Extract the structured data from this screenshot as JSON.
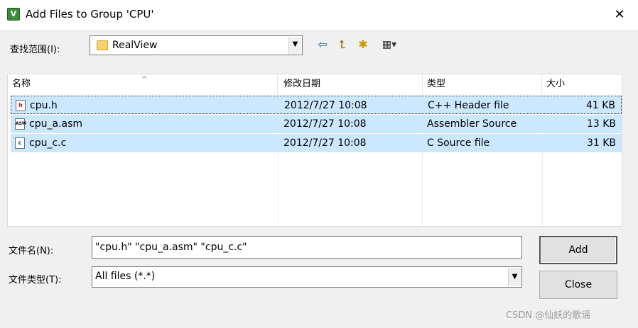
{
  "window": {
    "title": "Add Files to Group 'CPU'",
    "app_icon_text": "V",
    "close_glyph": "✕"
  },
  "lookin": {
    "label": "查找范围(I):",
    "value": "RealView"
  },
  "toolbar": {
    "back_icon": "back-arrow-icon",
    "up_icon": "up-folder-icon",
    "newfolder_icon": "new-folder-icon",
    "view_icon": "view-menu-icon"
  },
  "columns": [
    "名称",
    "修改日期",
    "类型",
    "大小"
  ],
  "files": [
    {
      "name": "cpu.h",
      "icon": "h",
      "modified": "2012/7/27 10:08",
      "type": "C++ Header file",
      "size": "41 KB"
    },
    {
      "name": "cpu_a.asm",
      "icon": "ASM",
      "modified": "2012/7/27 10:08",
      "type": "Assembler Source",
      "size": "13 KB"
    },
    {
      "name": "cpu_c.c",
      "icon": "c",
      "modified": "2012/7/27 10:08",
      "type": "C Source file",
      "size": "31 KB"
    }
  ],
  "filename": {
    "label": "文件名(N):",
    "value": "\"cpu.h\" \"cpu_a.asm\" \"cpu_c.c\""
  },
  "filetype": {
    "label": "文件类型(T):",
    "value": "All files (*.*)"
  },
  "buttons": {
    "add": "Add",
    "close": "Close"
  },
  "watermark": "CSDN @仙妖的歌谣",
  "colors": {
    "selection": "#cce8ff",
    "dialog_bg": "#f0f0f0"
  }
}
